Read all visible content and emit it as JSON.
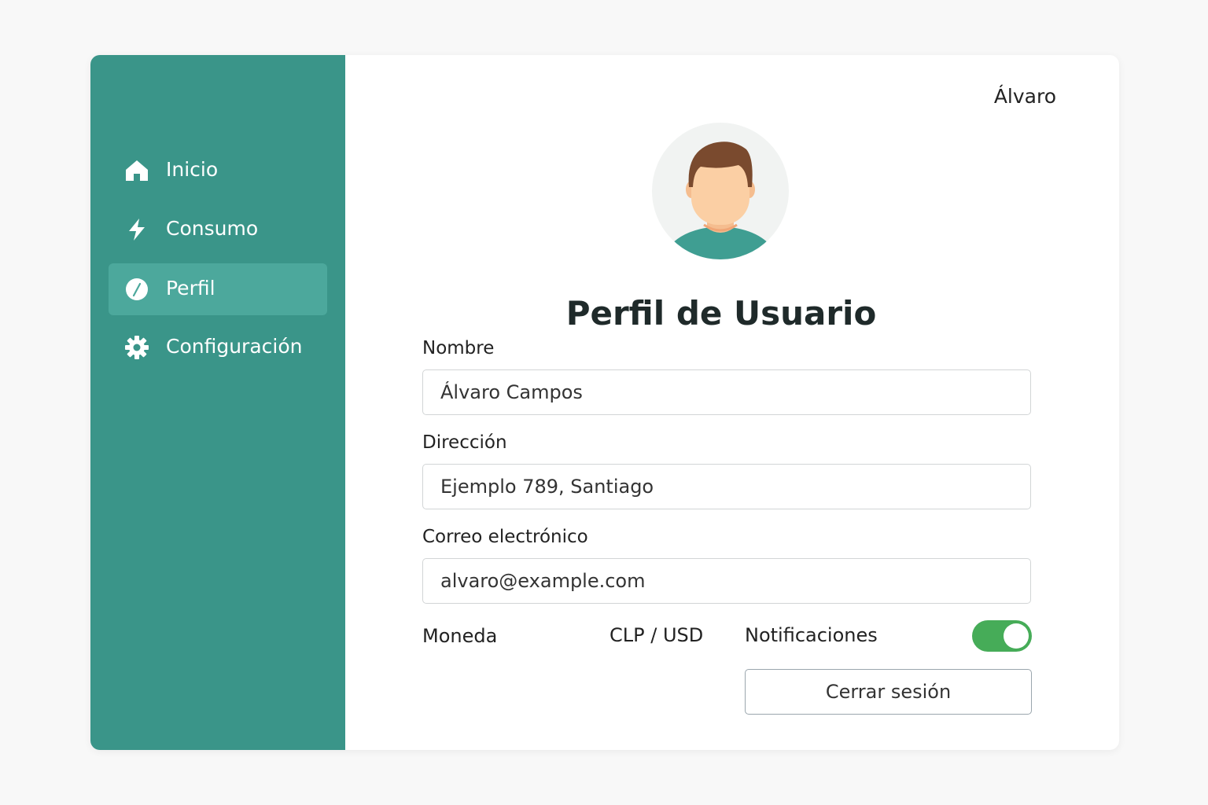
{
  "sidebar": {
    "items": [
      {
        "label": "Inicio",
        "icon": "home-icon"
      },
      {
        "label": "Consumo",
        "icon": "bolt-icon"
      },
      {
        "label": "Perfil",
        "icon": "profile-icon",
        "active": true
      },
      {
        "label": "Configuración",
        "icon": "gear-icon"
      }
    ]
  },
  "header": {
    "user_name": "Álvaro"
  },
  "profile": {
    "title": "Perfil de Usuario",
    "avatar_icon": "user-avatar"
  },
  "form": {
    "name_label": "Nombre",
    "name_value": "Álvaro Campos",
    "address_label": "Dirección",
    "address_value": "Ejemplo 789, Santiago",
    "email_label": "Correo electrónico",
    "email_value": "alvaro@example.com",
    "currency_label": "Moneda",
    "currency_value": "CLP / USD",
    "notifications_label": "Notificaciones",
    "notifications_enabled": true,
    "logout_label": "Cerrar sesión"
  },
  "colors": {
    "sidebar": "#3a9589",
    "sidebar_active": "#4ca89c",
    "toggle_on": "#46ac58"
  }
}
